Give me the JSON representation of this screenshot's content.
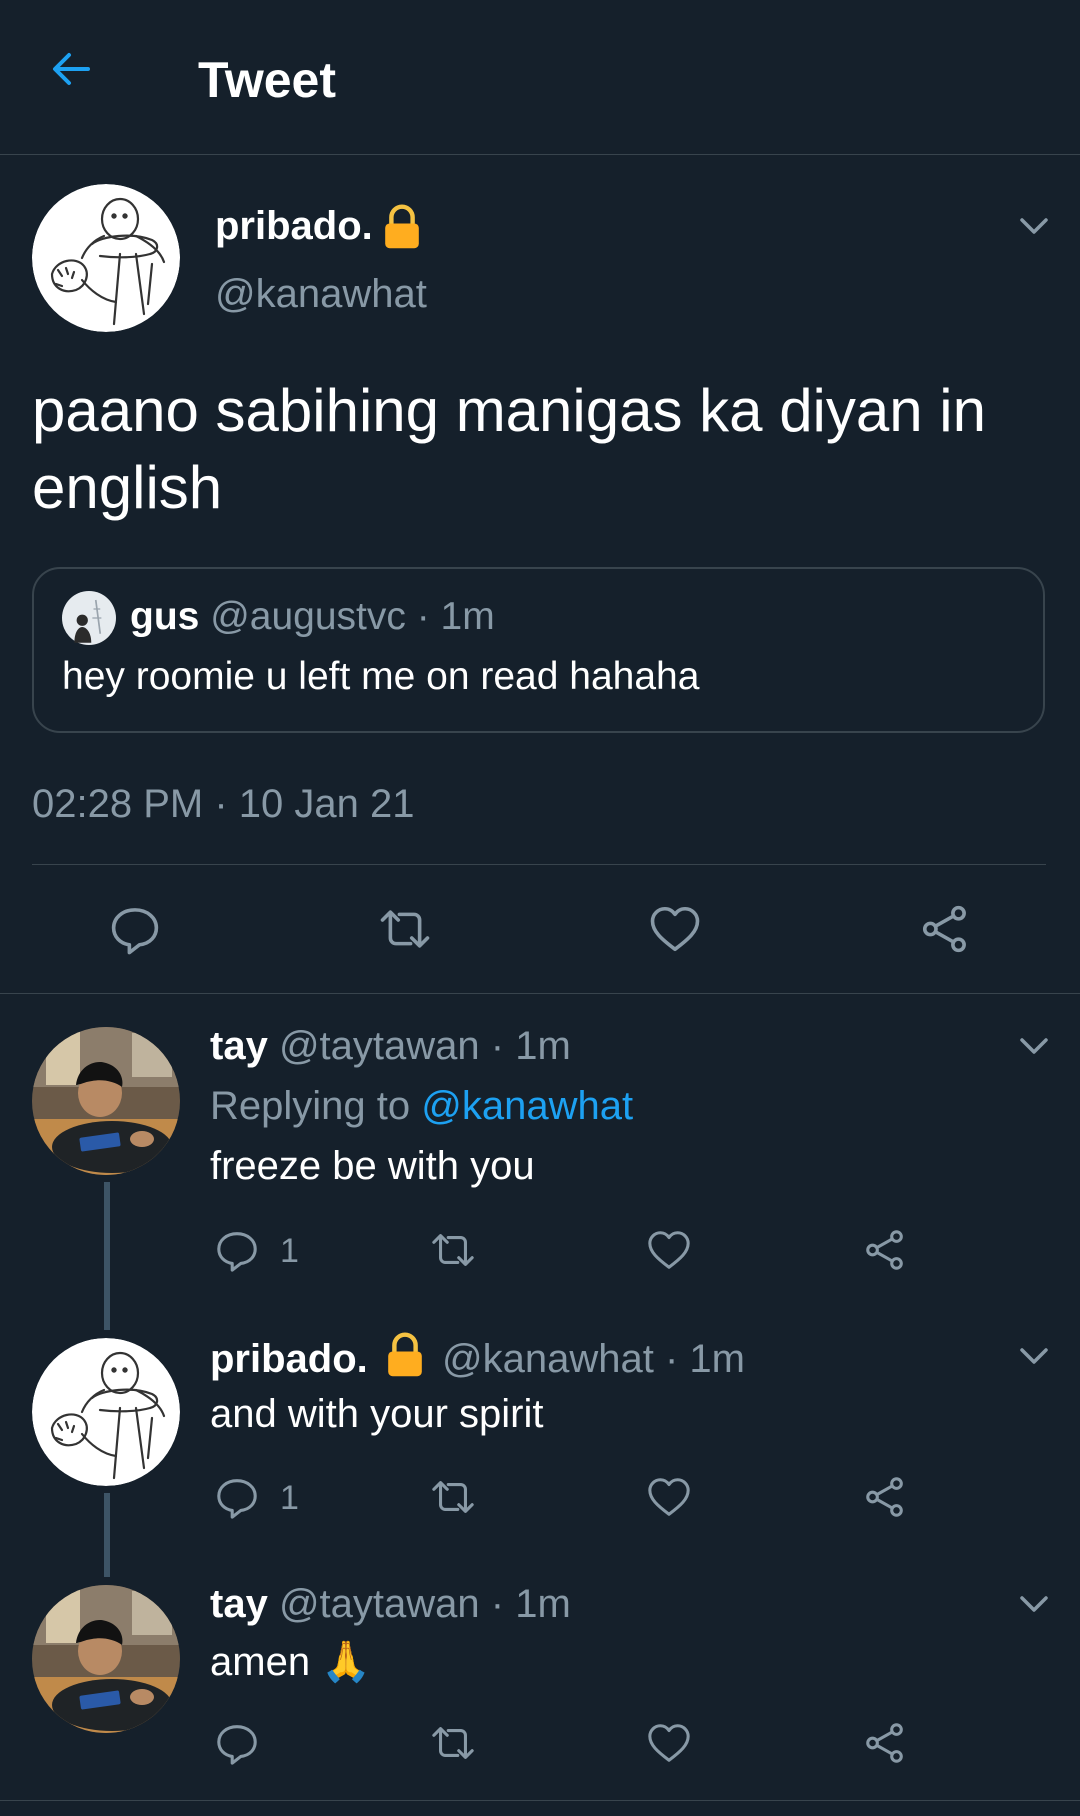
{
  "header": {
    "title": "Tweet"
  },
  "main_tweet": {
    "display_name": "pribado.",
    "handle": "@kanawhat",
    "text": "paano sabihing manigas ka diyan in english",
    "quote": {
      "name": "gus",
      "handle": "@augustvc",
      "time": "· 1m",
      "text": "hey roomie u left me on read hahaha"
    },
    "timestamp": "02:28 PM · 10 Jan 21"
  },
  "replies": [
    {
      "name": "tay",
      "handle": "@taytawan",
      "time": "· 1m",
      "replying_prefix": "Replying to",
      "replying_handle": "@kanawhat",
      "text": "freeze be with you",
      "reply_count": "1"
    },
    {
      "name": "pribado.",
      "handle": "@kanawhat",
      "time": "· 1m",
      "text": "and with your spirit",
      "reply_count": "1"
    },
    {
      "name": "tay",
      "handle": "@taytawan",
      "time": "· 1m",
      "text": "amen 🙏"
    }
  ],
  "colors": {
    "background": "#15202b",
    "accent": "#1da1f2",
    "muted": "#8899a6",
    "divider": "#38444d",
    "lock": "#ffad1f"
  }
}
